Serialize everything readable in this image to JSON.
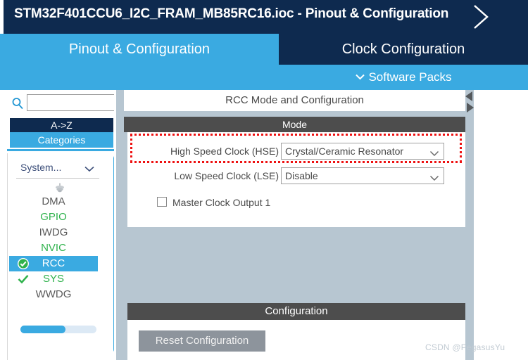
{
  "titlebar": {
    "filename_title": "STM32F401CCU6_I2C_FRAM_MB85RC16.ioc - Pinout & Configuration",
    "chevron_icon": "chevron-right-icon"
  },
  "tabs": {
    "active": "Pinout & Configuration",
    "inactive": "Clock Configuration",
    "software_packs": "Software Packs",
    "software_packs_chevron": "chevron-down-icon",
    "active_color": "#3aaae1",
    "inactive_color": "#0e2a4f"
  },
  "sidebar": {
    "search": {
      "icon": "search-icon",
      "value": "",
      "placeholder": ""
    },
    "sort_button": "A->Z",
    "categories_button": "Categories",
    "group": {
      "label": "System...",
      "chevron_icon": "chevron-down-icon",
      "collapse_icon": "collapse-handle-icon"
    },
    "items": [
      {
        "label": "DMA",
        "color": "#5a5a5a",
        "selected": false,
        "check": "none"
      },
      {
        "label": "GPIO",
        "color": "#2fb24c",
        "selected": false,
        "check": "none"
      },
      {
        "label": "IWDG",
        "color": "#5a5a5a",
        "selected": false,
        "check": "none"
      },
      {
        "label": "NVIC",
        "color": "#2fb24c",
        "selected": false,
        "check": "none"
      },
      {
        "label": "RCC",
        "color": "#ffffff",
        "selected": true,
        "check": "badge"
      },
      {
        "label": "SYS",
        "color": "#2fb24c",
        "selected": false,
        "check": "plain"
      },
      {
        "label": "WWDG",
        "color": "#5a5a5a",
        "selected": false,
        "check": "none"
      }
    ],
    "scrollbar_color": "#3aaae1"
  },
  "main": {
    "panel_title": "RCC Mode and Configuration",
    "mode_header": "Mode",
    "fields": [
      {
        "label": "High Speed Clock (HSE)",
        "value": "Crystal/Ceramic Resonator",
        "chevron_icon": "chevron-down-icon",
        "highlighted": true
      },
      {
        "label": "Low Speed Clock (LSE)",
        "value": "Disable",
        "chevron_icon": "chevron-down-icon",
        "highlighted": false
      }
    ],
    "checkbox": {
      "label": "Master Clock Output 1",
      "checked": false
    },
    "highlight_color": "#ee1111",
    "config_header": "Configuration",
    "reset_button": "Reset Configuration",
    "scroll_left_icon": "triangle-left-icon",
    "scroll_right_icon": "triangle-right-icon"
  },
  "watermark": "CSDN @PegasusYu"
}
